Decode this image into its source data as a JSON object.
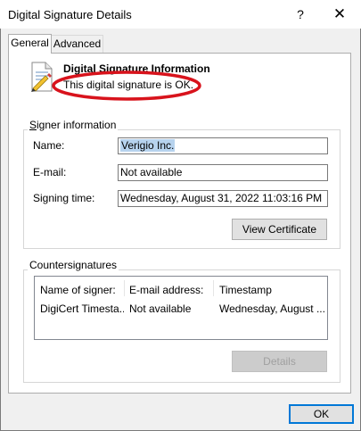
{
  "window": {
    "title": "Digital Signature Details",
    "help_glyph": "?",
    "close_glyph": "✕"
  },
  "tabs": [
    {
      "label": "General",
      "selected": true
    },
    {
      "label": "Advanced",
      "selected": false
    }
  ],
  "info": {
    "heading": "Digital Signature Information",
    "status": "This digital signature is OK.",
    "annotation_color": "#d8131c"
  },
  "signer": {
    "group_label": "Signer information",
    "group_label_access_key": "S",
    "fields": [
      {
        "label": "Name:",
        "value": "Verigio Inc."
      },
      {
        "label": "E-mail:",
        "value": "Not available"
      },
      {
        "label": "Signing time:",
        "value": "Wednesday, August 31, 2022 11:03:16 PM"
      }
    ],
    "view_certificate_label": "View Certificate"
  },
  "countersignatures": {
    "group_label": "Countersignatures",
    "columns": [
      "Name of signer:",
      "E-mail address:",
      "Timestamp"
    ],
    "rows": [
      [
        "DigiCert Timesta...",
        "Not available",
        "Wednesday, August ..."
      ]
    ],
    "details_label": "Details"
  },
  "footer": {
    "ok_label": "OK"
  }
}
